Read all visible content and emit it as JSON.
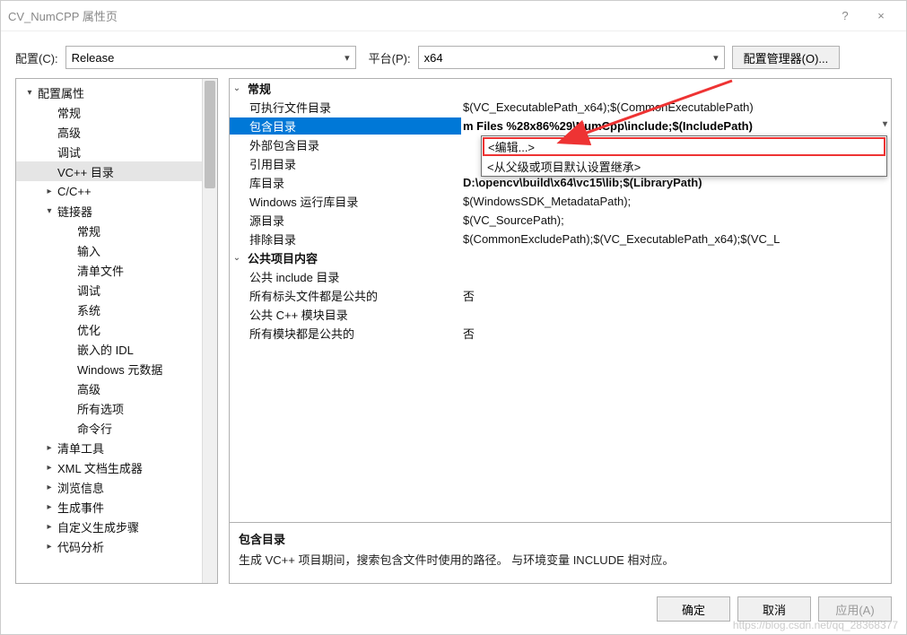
{
  "window": {
    "title": "CV_NumCPP 属性页",
    "help": "?",
    "close": "×"
  },
  "toolbar": {
    "config_label": "配置(C):",
    "config_value": "Release",
    "platform_label": "平台(P):",
    "platform_value": "x64",
    "manager_btn": "配置管理器(O)..."
  },
  "tree": [
    {
      "level": 0,
      "exp": "▾",
      "label": "配置属性",
      "sel": false
    },
    {
      "level": 1,
      "exp": "",
      "label": "常规",
      "sel": false
    },
    {
      "level": 1,
      "exp": "",
      "label": "高级",
      "sel": false
    },
    {
      "level": 1,
      "exp": "",
      "label": "调试",
      "sel": false
    },
    {
      "level": 1,
      "exp": "",
      "label": "VC++ 目录",
      "sel": true
    },
    {
      "level": 1,
      "exp": "▸",
      "label": "C/C++",
      "sel": false
    },
    {
      "level": 1,
      "exp": "▾",
      "label": "链接器",
      "sel": false
    },
    {
      "level": 2,
      "exp": "",
      "label": "常规",
      "sel": false
    },
    {
      "level": 2,
      "exp": "",
      "label": "输入",
      "sel": false
    },
    {
      "level": 2,
      "exp": "",
      "label": "清单文件",
      "sel": false
    },
    {
      "level": 2,
      "exp": "",
      "label": "调试",
      "sel": false
    },
    {
      "level": 2,
      "exp": "",
      "label": "系统",
      "sel": false
    },
    {
      "level": 2,
      "exp": "",
      "label": "优化",
      "sel": false
    },
    {
      "level": 2,
      "exp": "",
      "label": "嵌入的 IDL",
      "sel": false
    },
    {
      "level": 2,
      "exp": "",
      "label": "Windows 元数据",
      "sel": false
    },
    {
      "level": 2,
      "exp": "",
      "label": "高级",
      "sel": false
    },
    {
      "level": 2,
      "exp": "",
      "label": "所有选项",
      "sel": false
    },
    {
      "level": 2,
      "exp": "",
      "label": "命令行",
      "sel": false
    },
    {
      "level": 1,
      "exp": "▸",
      "label": "清单工具",
      "sel": false
    },
    {
      "level": 1,
      "exp": "▸",
      "label": "XML 文档生成器",
      "sel": false
    },
    {
      "level": 1,
      "exp": "▸",
      "label": "浏览信息",
      "sel": false
    },
    {
      "level": 1,
      "exp": "▸",
      "label": "生成事件",
      "sel": false
    },
    {
      "level": 1,
      "exp": "▸",
      "label": "自定义生成步骤",
      "sel": false
    },
    {
      "level": 1,
      "exp": "▸",
      "label": "代码分析",
      "sel": false
    }
  ],
  "grid": {
    "cat1": "常规",
    "rows1": [
      {
        "key": "可执行文件目录",
        "val": "$(VC_ExecutablePath_x64);$(CommonExecutablePath)",
        "sel": false
      },
      {
        "key": "包含目录",
        "val": "m Files %28x86%29\\NumCpp\\include;$(IncludePath)",
        "sel": true
      },
      {
        "key": "外部包含目录",
        "val": "",
        "sel": false
      },
      {
        "key": "引用目录",
        "val": "",
        "sel": false
      },
      {
        "key": "库目录",
        "val": "D:\\opencv\\build\\x64\\vc15\\lib;$(LibraryPath)",
        "sel": false,
        "bold": true
      },
      {
        "key": "Windows 运行库目录",
        "val": "$(WindowsSDK_MetadataPath);",
        "sel": false
      },
      {
        "key": "源目录",
        "val": "$(VC_SourcePath);",
        "sel": false
      },
      {
        "key": "排除目录",
        "val": "$(CommonExcludePath);$(VC_ExecutablePath_x64);$(VC_L",
        "sel": false
      }
    ],
    "cat2": "公共项目内容",
    "rows2": [
      {
        "key": "公共 include 目录",
        "val": ""
      },
      {
        "key": "所有标头文件都是公共的",
        "val": "否"
      },
      {
        "key": "公共 C++ 模块目录",
        "val": ""
      },
      {
        "key": "所有模块都是公共的",
        "val": "否"
      }
    ]
  },
  "dropdown": {
    "edit": "<编辑...>",
    "inherit": "<从父级或项目默认设置继承>"
  },
  "desc": {
    "title": "包含目录",
    "body": "生成 VC++ 项目期间，搜索包含文件时使用的路径。   与环境变量 INCLUDE 相对应。"
  },
  "footer": {
    "ok": "确定",
    "cancel": "取消",
    "apply": "应用(A)"
  },
  "watermark": "https://blog.csdn.net/qq_28368377"
}
